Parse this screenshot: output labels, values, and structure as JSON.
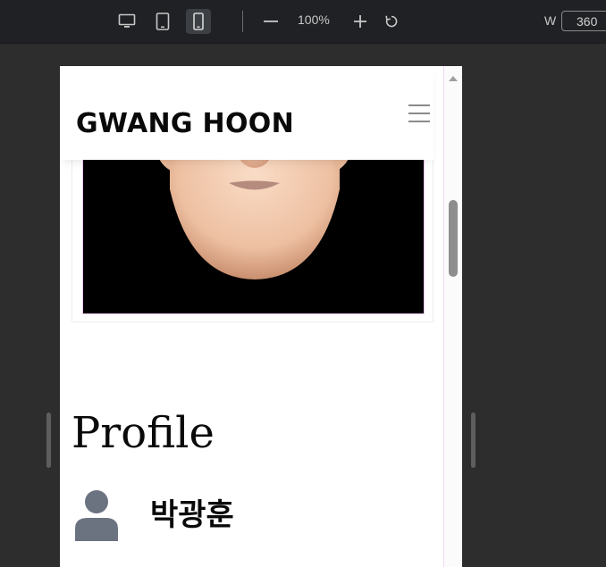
{
  "toolbar": {
    "zoom_level": "100%",
    "width_label": "W",
    "width_value": "360"
  },
  "site": {
    "title": "GWANG HOON"
  },
  "profile": {
    "heading": "Profile",
    "name": "박광훈"
  },
  "icons": {
    "desktop": "desktop-icon",
    "tablet": "tablet-icon",
    "mobile": "mobile-icon",
    "zoom_out": "minus-icon",
    "zoom_in": "plus-icon",
    "reset": "reset-icon",
    "menu": "hamburger-menu-icon",
    "user": "user-icon"
  },
  "colors": {
    "toolbar_bg": "#202124",
    "workspace_bg": "#2d2d2d",
    "active_device": "#3c3f44",
    "avatar": "#6b7280"
  }
}
